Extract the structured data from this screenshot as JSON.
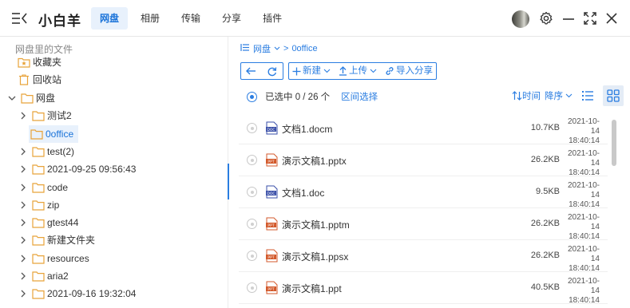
{
  "app": {
    "title": "小白羊"
  },
  "nav": {
    "tabs": [
      "网盘",
      "相册",
      "传输",
      "分享",
      "插件"
    ],
    "active_tab": "网盘"
  },
  "sidebar": {
    "header": "网盘里的文件",
    "items": [
      {
        "label": "收藏夹",
        "icon": "star-folder-icon"
      },
      {
        "label": "回收站",
        "icon": "trash-icon"
      },
      {
        "label": "网盘",
        "icon": "folder-icon",
        "expanded": true
      },
      {
        "label": "测试2",
        "icon": "folder-icon"
      },
      {
        "label": "0office",
        "icon": "folder-icon",
        "selected": true
      },
      {
        "label": "test(2)",
        "icon": "folder-icon"
      },
      {
        "label": "2021-09-25 09:56:43",
        "icon": "folder-icon"
      },
      {
        "label": "code",
        "icon": "folder-icon"
      },
      {
        "label": "zip",
        "icon": "folder-icon"
      },
      {
        "label": "gtest44",
        "icon": "folder-icon"
      },
      {
        "label": "新建文件夹",
        "icon": "folder-icon"
      },
      {
        "label": "resources",
        "icon": "folder-icon"
      },
      {
        "label": "aria2",
        "icon": "folder-icon"
      },
      {
        "label": "2021-09-16 19:32:04",
        "icon": "folder-icon"
      }
    ]
  },
  "breadcrumb": {
    "root": "网盘",
    "current": "0office"
  },
  "toolbar": {
    "new_label": "新建",
    "upload_label": "上传",
    "import_share_label": "导入分享"
  },
  "selection": {
    "text": "已选中 0 / 26 个",
    "range_label": "区间选择"
  },
  "sort": {
    "field": "时间",
    "order": "降序"
  },
  "files": [
    {
      "name": "文档1.docm",
      "size": "10.7KB",
      "date": "2021-10-14",
      "time": "18:40:14",
      "type": "doc"
    },
    {
      "name": "演示文稿1.pptx",
      "size": "26.2KB",
      "date": "2021-10-14",
      "time": "18:40:14",
      "type": "ppt"
    },
    {
      "name": "文档1.doc",
      "size": "9.5KB",
      "date": "2021-10-14",
      "time": "18:40:14",
      "type": "doc"
    },
    {
      "name": "演示文稿1.pptm",
      "size": "26.2KB",
      "date": "2021-10-14",
      "time": "18:40:14",
      "type": "ppt"
    },
    {
      "name": "演示文稿1.ppsx",
      "size": "26.2KB",
      "date": "2021-10-14",
      "time": "18:40:14",
      "type": "ppt"
    },
    {
      "name": "演示文稿1.ppt",
      "size": "40.5KB",
      "date": "2021-10-14",
      "time": "18:40:14",
      "type": "ppt"
    }
  ],
  "colors": {
    "accent": "#2a7de1",
    "folder": "#e8a33a",
    "doc_icon": "#3a4fa8",
    "ppt_icon": "#d35a2c"
  }
}
